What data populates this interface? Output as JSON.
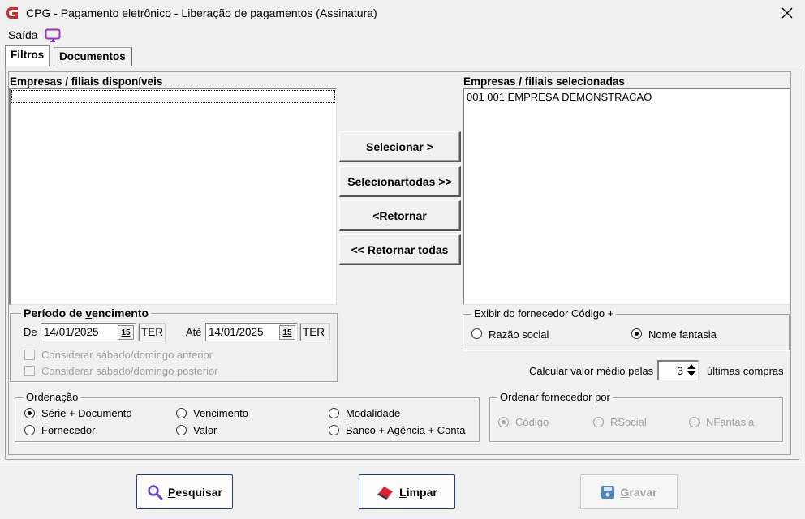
{
  "window": {
    "title": "CPG - Pagamento eletrônico - Liberação de pagamentos (Assinatura)",
    "close_label": "✕"
  },
  "menu": {
    "saida": "Saída"
  },
  "tabs": [
    {
      "label": "Filtros",
      "active": true
    },
    {
      "label": "Documentos",
      "active": false
    }
  ],
  "empresas": {
    "available_label": "Empresas / filiais disponíveis",
    "selected_label": "Empresas / filiais selecionadas",
    "selected_items": [
      "001 001 EMPRESA DEMONSTRACAO"
    ]
  },
  "transfer_buttons": {
    "selecionar": [
      "Sele",
      "c",
      "ionar >"
    ],
    "selecionar_todas": [
      "Selecionar ",
      "t",
      "odas >>"
    ],
    "retornar": [
      "< ",
      "R",
      "etornar"
    ],
    "retornar_todas": [
      "<< R",
      "e",
      "tornar todas"
    ]
  },
  "periodo": {
    "title": [
      "Período de ",
      "v",
      "encimento"
    ],
    "de_label": "De",
    "de_value": "14/01/2025",
    "de_day": "TER",
    "ate_label": "Até",
    "ate_value": "14/01/2025",
    "ate_day": "TER",
    "calendar_glyph": "15",
    "chk_anterior": "Considerar sábado/domingo anterior",
    "chk_posterior": "Considerar sábado/domingo posterior"
  },
  "exibir": {
    "title": "Exibir do fornecedor Código +",
    "options": [
      "Razão social",
      "Nome fantasia"
    ],
    "selected": "Nome fantasia"
  },
  "calcular": {
    "label": "Calcular valor médio pelas",
    "value": "3",
    "suffix": "últimas compras"
  },
  "ordenacao": {
    "title": "Ordenação",
    "options": [
      "Série + Documento",
      "Vencimento",
      "Modalidade",
      "Fornecedor",
      "Valor",
      "Banco + Agência + Conta"
    ],
    "selected": "Série + Documento"
  },
  "ordenar_fornecedor": {
    "title": "Ordenar fornecedor por",
    "options": [
      "Código",
      "RSocial",
      "NFantasia"
    ],
    "selected": "Código",
    "enabled": false
  },
  "actions": {
    "pesquisar": [
      "P",
      "esquisar"
    ],
    "limpar": [
      "L",
      "impar"
    ],
    "gravar": [
      "G",
      "ravar"
    ]
  },
  "colors": {
    "app_icon": "#d42a1f",
    "monitor_icon": "#9b2fd6",
    "search_icon": "#6b3fc9",
    "eraser_icon": "#e0202a",
    "button_border": "#1f3e7a",
    "disabled_text": "#a0a0a0"
  },
  "icons": {
    "app": "app-logo-icon",
    "monitor": "monitor-icon",
    "search": "search-icon",
    "eraser": "eraser-icon",
    "save": "floppy-disk-icon"
  }
}
